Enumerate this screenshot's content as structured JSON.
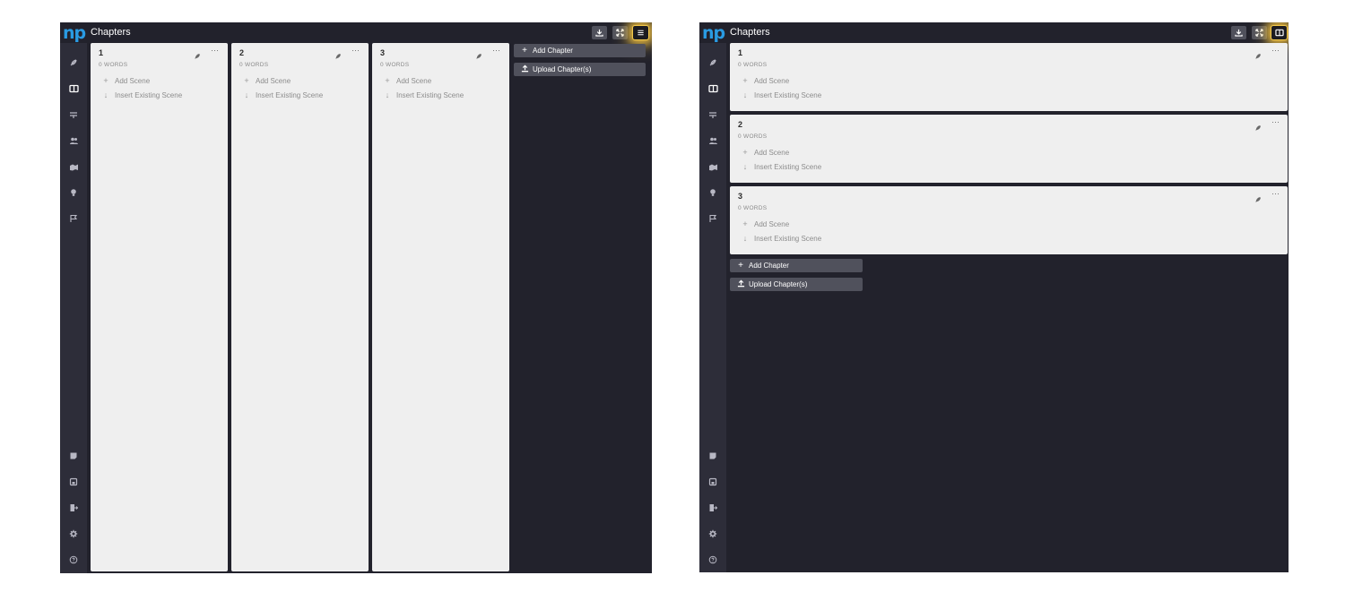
{
  "panels": [
    {
      "layout": "board",
      "app": {
        "logo": "np",
        "title": "Chapters"
      },
      "toolbar": [
        {
          "icon": "download-icon",
          "highlighted": false
        },
        {
          "icon": "fullscreen-icon",
          "highlighted": false
        },
        {
          "icon": "list-view-icon",
          "highlighted": true
        }
      ],
      "chapters": [
        {
          "number": "1",
          "words": "0 WORDS",
          "add_scene": "Add Scene",
          "insert_scene": "Insert Existing Scene"
        },
        {
          "number": "2",
          "words": "0 WORDS",
          "add_scene": "Add Scene",
          "insert_scene": "Insert Existing Scene"
        },
        {
          "number": "3",
          "words": "0 WORDS",
          "add_scene": "Add Scene",
          "insert_scene": "Insert Existing Scene"
        }
      ],
      "actions": {
        "add_chapter": "Add Chapter",
        "upload_chapters": "Upload Chapter(s)"
      }
    },
    {
      "layout": "list",
      "app": {
        "logo": "np",
        "title": "Chapters"
      },
      "toolbar": [
        {
          "icon": "download-icon",
          "highlighted": false
        },
        {
          "icon": "fullscreen-icon",
          "highlighted": false
        },
        {
          "icon": "board-view-icon",
          "highlighted": true
        }
      ],
      "chapters": [
        {
          "number": "1",
          "words": "0 WORDS",
          "add_scene": "Add Scene",
          "insert_scene": "Insert Existing Scene"
        },
        {
          "number": "2",
          "words": "0 WORDS",
          "add_scene": "Add Scene",
          "insert_scene": "Insert Existing Scene"
        },
        {
          "number": "3",
          "words": "0 WORDS",
          "add_scene": "Add Scene",
          "insert_scene": "Insert Existing Scene"
        }
      ],
      "actions": {
        "add_chapter": "Add Chapter",
        "upload_chapters": "Upload Chapter(s)"
      }
    }
  ],
  "sidebar_icons_top": [
    "quill-icon",
    "chapters-icon",
    "plot-icon",
    "characters-icon",
    "locations-icon",
    "ideas-icon",
    "flag-icon"
  ],
  "sidebar_icons_bottom": [
    "notes-icon",
    "save-icon",
    "export-icon",
    "settings-icon",
    "help-icon"
  ],
  "colors": {
    "background": "#22222c",
    "sidebar": "#2d2d39",
    "card": "#efefef",
    "button": "#50515c",
    "logo": "#2a9be2",
    "highlight": "#f3c94b"
  }
}
